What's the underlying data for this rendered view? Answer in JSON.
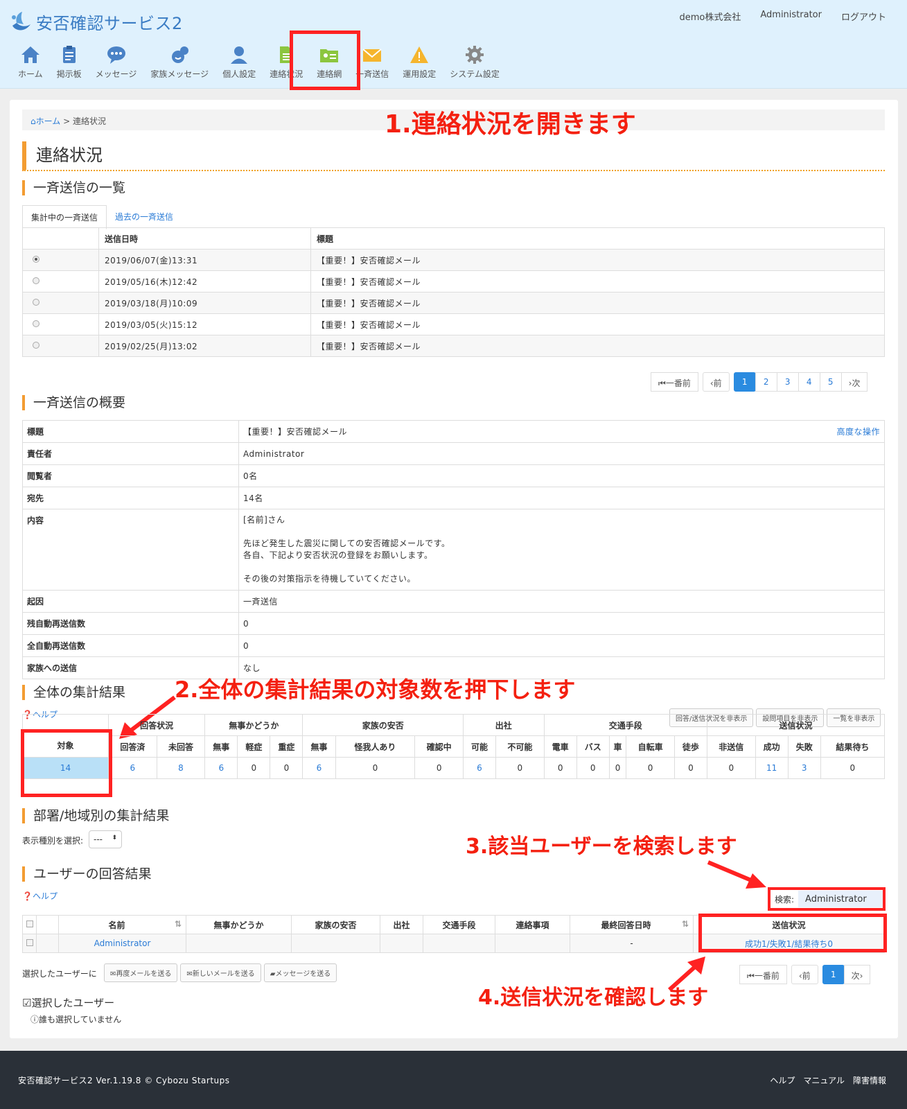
{
  "header": {
    "app_title": "安否確認サービス2",
    "company": "demo株式会社",
    "user": "Administrator",
    "logout": "ログアウト",
    "nav": [
      {
        "label": "ホーム",
        "icon": "home-icon"
      },
      {
        "label": "掲示板",
        "icon": "board-icon"
      },
      {
        "label": "メッセージ",
        "icon": "message-icon"
      },
      {
        "label": "家族メッセージ",
        "icon": "family-message-icon"
      },
      {
        "label": "個人設定",
        "icon": "person-icon"
      },
      {
        "label": "連絡状況",
        "icon": "document-icon"
      },
      {
        "label": "連絡網",
        "icon": "contact-card-icon"
      },
      {
        "label": "一斉送信",
        "icon": "mail-icon"
      },
      {
        "label": "運用設定",
        "icon": "warning-icon"
      },
      {
        "label": "システム設定",
        "icon": "gear-icon"
      }
    ]
  },
  "breadcrumb": {
    "home": "ホーム",
    "sep": ">",
    "current": "連絡状況"
  },
  "annotations": {
    "a1": "1.連絡状況を開きます",
    "a2": "2.全体の集計結果の対象数を押下します",
    "a3": "3.該当ユーザーを検索します",
    "a4": "4.送信状況を確認します"
  },
  "page_title": "連絡状況",
  "list": {
    "heading": "一斉送信の一覧",
    "tabs": [
      "集計中の一斉送信",
      "過去の一斉送信"
    ],
    "columns": [
      "送信日時",
      "標題"
    ],
    "rows": [
      {
        "date": "2019/06/07(金)13:31",
        "title": "【重要！】安否確認メール"
      },
      {
        "date": "2019/05/16(木)12:42",
        "title": "【重要！】安否確認メール"
      },
      {
        "date": "2019/03/18(月)10:09",
        "title": "【重要！】安否確認メール"
      },
      {
        "date": "2019/03/05(火)15:12",
        "title": "【重要！】安否確認メール"
      },
      {
        "date": "2019/02/25(月)13:02",
        "title": "【重要！】安否確認メール"
      }
    ],
    "pager": {
      "first": "一番前",
      "prev": "前",
      "pages": [
        "1",
        "2",
        "3",
        "4",
        "5"
      ],
      "next": "次"
    }
  },
  "summary": {
    "heading": "一斉送信の概要",
    "advanced": "高度な操作",
    "rows": [
      {
        "k": "標題",
        "v": "【重要！】安否確認メール"
      },
      {
        "k": "責任者",
        "v": "Administrator"
      },
      {
        "k": "閲覧者",
        "v": "0名"
      },
      {
        "k": "宛先",
        "v": "14名"
      },
      {
        "k": "内容",
        "v1": "[名前]さん",
        "v2": "先ほど発生した震災に関しての安否確認メールです。",
        "v3": "各自、下記より安否状況の登録をお願いします。",
        "v4": "その後の対策指示を待機していてください。"
      },
      {
        "k": "起因",
        "v": "一斉送信"
      },
      {
        "k": "残自動再送信数",
        "v": "0"
      },
      {
        "k": "全自動再送信数",
        "v": "0"
      },
      {
        "k": "家族への送信",
        "v": "なし"
      }
    ]
  },
  "totals": {
    "heading": "全体の集計結果",
    "help": "ヘルプ",
    "buttons": [
      "回答/送信状況を非表示",
      "設問項目を非表示",
      "一覧を非表示"
    ],
    "target_label": "対象",
    "target_value": "14",
    "groups": [
      "回答状況",
      "無事かどうか",
      "家族の安否",
      "出社",
      "交通手段",
      "送信状況"
    ],
    "cols": [
      "回答済",
      "未回答",
      "無事",
      "軽症",
      "重症",
      "無事",
      "怪我人あり",
      "確認中",
      "可能",
      "不可能",
      "電車",
      "バス",
      "車",
      "自転車",
      "徒歩",
      "非送信",
      "成功",
      "失敗",
      "結果待ち"
    ],
    "vals": [
      "6",
      "8",
      "6",
      "0",
      "0",
      "6",
      "0",
      "0",
      "6",
      "0",
      "0",
      "0",
      "0",
      "0",
      "0",
      "0",
      "11",
      "3",
      "0"
    ]
  },
  "dept": {
    "heading": "部署/地域別の集計結果",
    "label": "表示種別を選択:",
    "select": "---"
  },
  "users": {
    "heading": "ユーザーの回答結果",
    "help": "ヘルプ",
    "search_label": "検索:",
    "search_value": "Administrator",
    "columns": [
      "名前",
      "無事かどうか",
      "家族の安否",
      "出社",
      "交通手段",
      "連絡事項",
      "最終回答日時",
      "送信状況"
    ],
    "row": {
      "name": "Administrator",
      "last": "-",
      "status": "成功1/失敗1/結果待ち0"
    },
    "selected_label": "選択したユーザーに",
    "actions": [
      "再度メールを送る",
      "新しいメールを送る",
      "メッセージを送る"
    ],
    "pager": {
      "first": "一番前",
      "prev": "前",
      "page": "1",
      "next": "次"
    },
    "sel_heading": "選択したユーザー",
    "none": "誰も選択していません"
  },
  "footer": {
    "version": "安否確認サービス2 Ver.1.19.8 © Cybozu Startups",
    "links": [
      "ヘルプ",
      "マニュアル",
      "障害情報"
    ]
  },
  "colors": {
    "accent": "#f39c32",
    "link": "#2a7bd6",
    "annotation": "#f42010",
    "header_bg": "#dff1fd"
  }
}
